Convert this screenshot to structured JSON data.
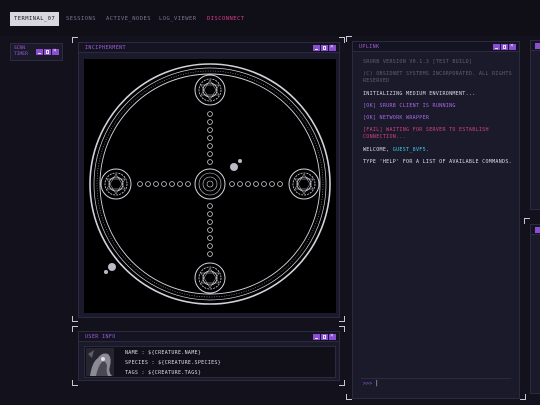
{
  "topbar": {
    "tabs": [
      {
        "label": "TERMINAL_07",
        "active": true
      },
      {
        "label": "SESSIONS"
      },
      {
        "label": "ACTIVE_NODES"
      },
      {
        "label": "LOG_VIEWER"
      },
      {
        "label": "DISCONNECT",
        "accent": "#d63b86"
      }
    ]
  },
  "side_panel": {
    "title": "SCRN TIMER"
  },
  "sigil_panel": {
    "title": "INCIPHERMENT"
  },
  "uplink_panel": {
    "title": "UPLINK",
    "lines": [
      "SRURB VERSION V0.1.3 [TEST BUILD]",
      "(C) OBSIDNET SYSTEMS INCORPORATED. ALL RIGHTS RESERVED",
      "INITIALIZING MEDIUM ENVIRONMENT...",
      "[OK] SRURB CLIENT IS RUNNING",
      "[OK] NETWORK WRAPPER",
      "[FAIL] WAITING FOR SERVER TO ESTABLISH CONNECTION...",
      "WELCOME,",
      "GUEST_8VF5.",
      "TYPE 'HELP' FOR A LIST OF AVAILABLE COMMANDS."
    ],
    "prompt": ">>>",
    "cursor": "|"
  },
  "user_info": {
    "title": "USER INFO",
    "name_line": "NAME : ${CREATURE.NAME}",
    "species_line": "SPECIES : ${CREATURE.SPECIES}",
    "tags_line": "TAGS : ${CREATURE.TAGS}"
  },
  "colors": {
    "accent_purple": "#9d5cd6",
    "accent_pink": "#d63b86",
    "accent_cyan": "#3fc8e6",
    "background": "#12111c",
    "panel": "#1b1a2b"
  }
}
